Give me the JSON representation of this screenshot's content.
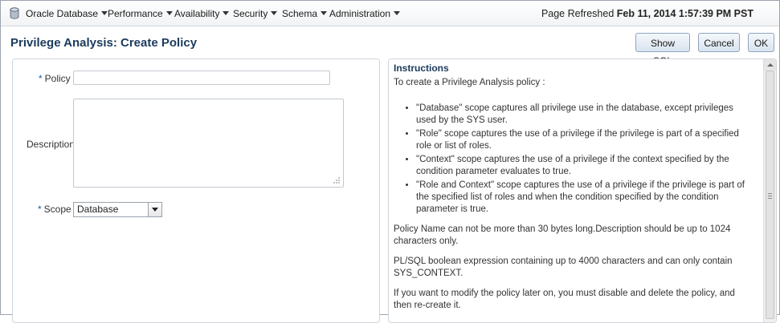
{
  "menubar": {
    "items": [
      {
        "label": "Oracle Database"
      },
      {
        "label": "Performance"
      },
      {
        "label": "Availability"
      },
      {
        "label": "Security"
      },
      {
        "label": "Schema"
      },
      {
        "label": "Administration"
      }
    ],
    "refresh_label": "Page Refreshed",
    "refresh_time": "Feb 11, 2014 1:57:39 PM PST"
  },
  "header": {
    "title": "Privilege Analysis: Create Policy",
    "show_sql": "Show SQL",
    "cancel": "Cancel",
    "ok": "OK"
  },
  "form": {
    "required_marker": "*",
    "policy_label": "Policy",
    "policy_value": "",
    "description_label": "Description",
    "description_value": "",
    "scope_label": "Scope",
    "scope_value": "Database"
  },
  "instructions": {
    "title": "Instructions",
    "intro": "To create a Privilege Analysis policy :",
    "bullets": [
      "\"Database\" scope captures all privilege use in the database, except privileges used by the SYS user.",
      "\"Role\" scope captures the use of a privilege if the privilege is part of a specified role or list of roles.",
      "\"Context\" scope captures the use of a privilege if the context specified by the condition parameter evaluates to true.",
      "\"Role and Context\" scope captures the use of a privilege if the privilege is part of the specified list of roles and when the condition specified by the condition parameter is true."
    ],
    "para1": "Policy Name can not be more than 30 bytes long.Description should be up to 1024 characters only.",
    "para2": "PL/SQL boolean expression containing up to 4000 characters and can only contain SYS_CONTEXT.",
    "para3": "If you want to modify the policy later on, you must disable and delete the policy, and then re-create it."
  }
}
